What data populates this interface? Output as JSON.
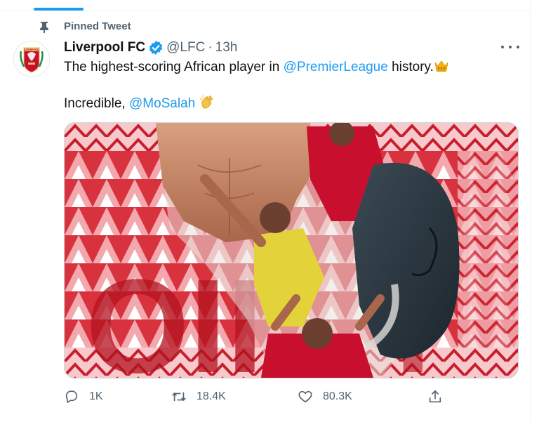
{
  "pinned_label": "Pinned Tweet",
  "author": {
    "name": "Liverpool FC",
    "handle": "@LFC",
    "time": "13h",
    "separator": "·",
    "avatar_text": "LIVERPOOL"
  },
  "tweet": {
    "line1_before": "The highest-scoring African player in ",
    "line1_mention": "@PremierLeague",
    "line1_after": " history.",
    "line2_before": "Incredible, ",
    "line2_mention": "@MoSalah"
  },
  "actions": {
    "reply_count": "1K",
    "retweet_count": "18.4K",
    "like_count": "80.3K"
  },
  "colors": {
    "accent": "#1d9bf0",
    "secondary_text": "#536471",
    "lfc_red": "#c8102e"
  },
  "icons": [
    "pin-icon",
    "verified-badge-icon",
    "more-icon",
    "crown-emoji",
    "clapping-hands-emoji",
    "reply-icon",
    "retweet-icon",
    "like-icon",
    "share-icon"
  ]
}
